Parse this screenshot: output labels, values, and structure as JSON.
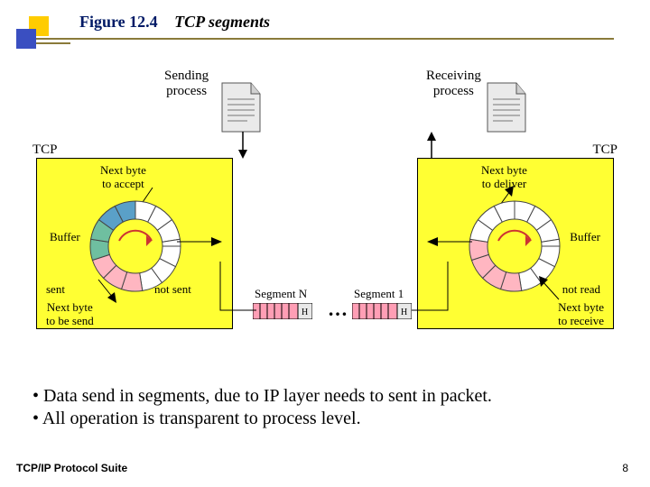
{
  "title": {
    "figure": "Figure 12.4",
    "caption": "TCP segments"
  },
  "diagram": {
    "sending_process": "Sending\nprocess",
    "receiving_process": "Receiving\nprocess",
    "tcp_left": "TCP",
    "tcp_right": "TCP",
    "left_box": {
      "next_byte_accept": "Next byte\nto accept",
      "buffer": "Buffer",
      "sent": "sent",
      "not_sent": "not sent",
      "next_byte_send": "Next byte\nto be send"
    },
    "right_box": {
      "next_byte_deliver": "Next byte\nto deliver",
      "buffer": "Buffer",
      "not_read": "not read",
      "next_byte_receive": "Next byte\nto receive"
    },
    "segment_n": "Segment N",
    "segment_1": "Segment 1",
    "ellipsis": "…"
  },
  "bullets": [
    "Data send in segments, due to IP layer needs to sent in packet.",
    "All operation is transparent to process level."
  ],
  "footer": {
    "suite": "TCP/IP Protocol Suite",
    "page": "8"
  }
}
